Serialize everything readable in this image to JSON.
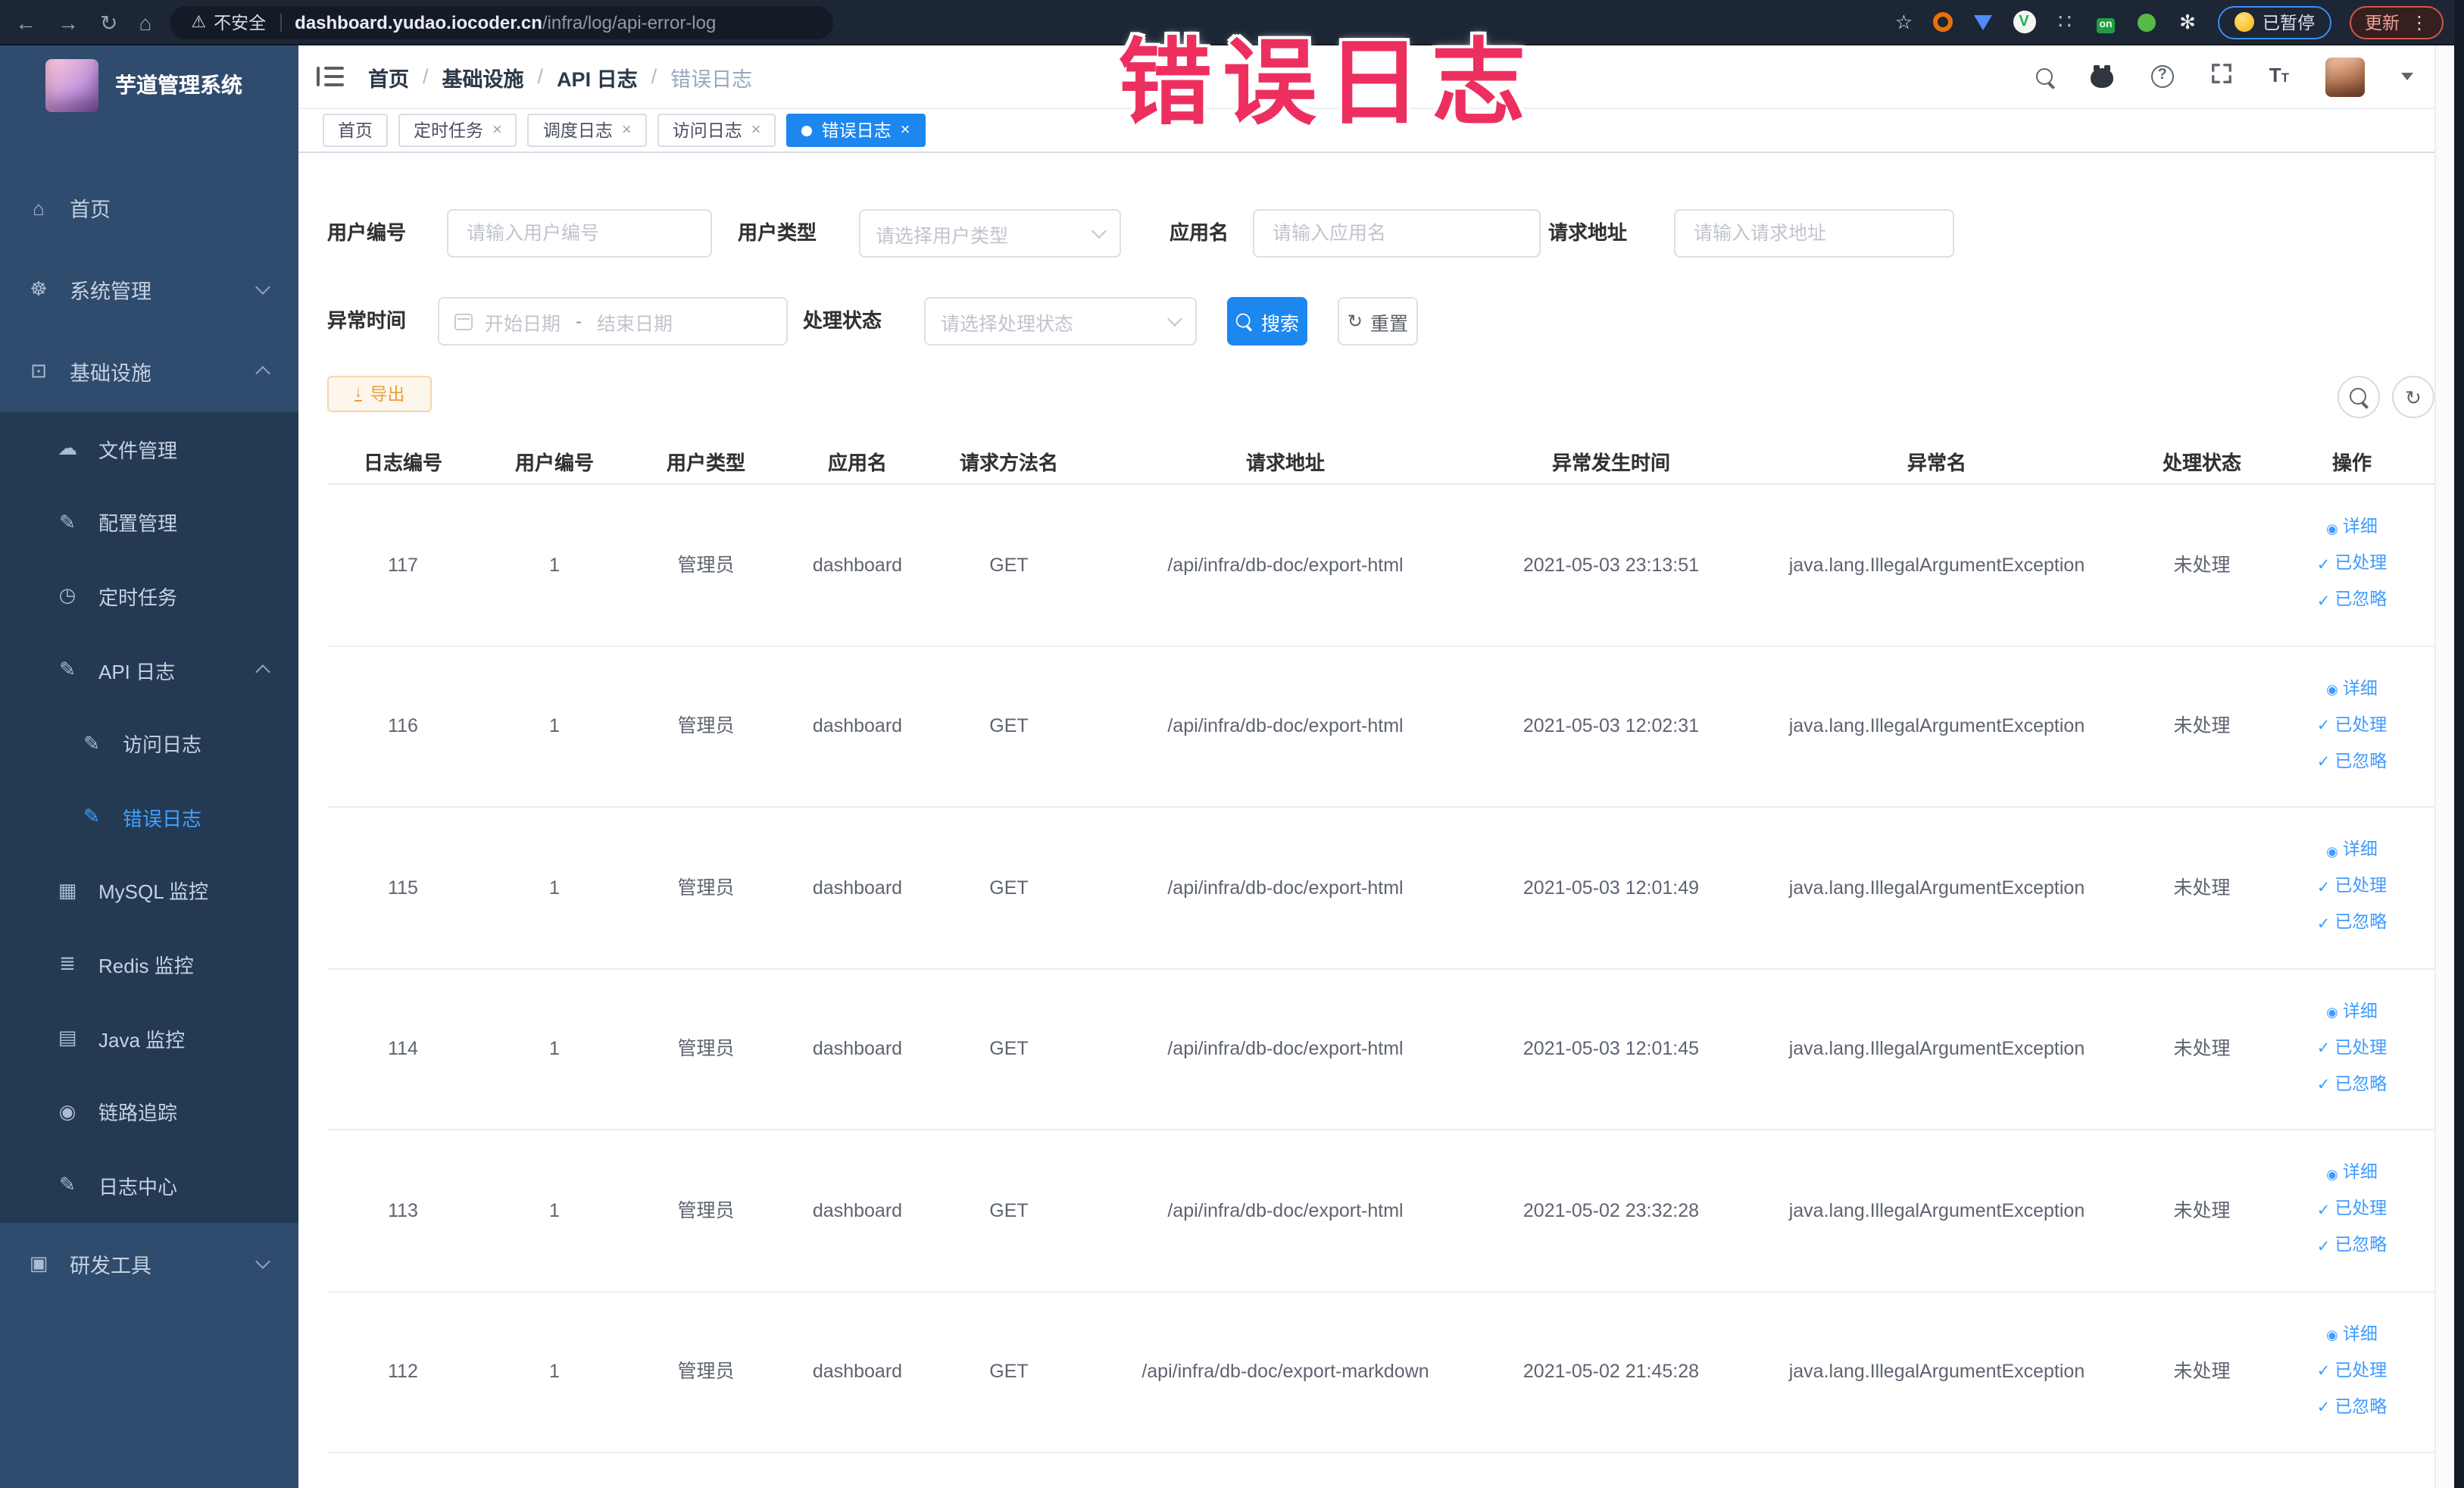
{
  "browser": {
    "security_label": "不安全",
    "url_domain": "dashboard.yudao.iocoder.cn",
    "url_path": "/infra/log/api-error-log",
    "paused_label": "已暂停",
    "update_label": "更新"
  },
  "annotation": {
    "text": "错误日志",
    "color": "#ed2f5f"
  },
  "sidebar": {
    "title": "芋道管理系统",
    "items": [
      {
        "key": "home",
        "label": "首页",
        "icon": "dashboard-icon",
        "level": 0,
        "sub": false
      },
      {
        "key": "system-mgmt",
        "label": "系统管理",
        "icon": "gear-icon",
        "level": 0,
        "sub": false,
        "arrow": "down"
      },
      {
        "key": "infrastructure",
        "label": "基础设施",
        "icon": "infra-monitor-icon",
        "level": 0,
        "sub": false,
        "arrow": "up"
      },
      {
        "key": "file-mgmt",
        "label": "文件管理",
        "icon": "cloud-upload-icon",
        "level": 1,
        "sub": true
      },
      {
        "key": "config-mgmt",
        "label": "配置管理",
        "icon": "edit-square-icon",
        "level": 1,
        "sub": true
      },
      {
        "key": "cron-job",
        "label": "定时任务",
        "icon": "clock-icon",
        "level": 1,
        "sub": true
      },
      {
        "key": "api-log",
        "label": "API 日志",
        "icon": "log-edit-icon",
        "level": 1,
        "sub": true,
        "arrow": "up"
      },
      {
        "key": "access-log",
        "label": "访问日志",
        "icon": "log-edit-icon",
        "level": 2,
        "sub": true
      },
      {
        "key": "error-log",
        "label": "错误日志",
        "icon": "log-edit-icon",
        "level": 2,
        "sub": true,
        "active": true
      },
      {
        "key": "mysql-monitor",
        "label": "MySQL 监控",
        "icon": "chart-icon",
        "level": 1,
        "sub": true
      },
      {
        "key": "redis-monitor",
        "label": "Redis 监控",
        "icon": "layers-icon",
        "level": 1,
        "sub": true
      },
      {
        "key": "java-monitor",
        "label": "Java 监控",
        "icon": "monitor-icon",
        "level": 1,
        "sub": true
      },
      {
        "key": "trace",
        "label": "链路追踪",
        "icon": "eye-icon",
        "level": 1,
        "sub": true
      },
      {
        "key": "log-center",
        "label": "日志中心",
        "icon": "log-edit-icon",
        "level": 1,
        "sub": true
      },
      {
        "key": "dev-tools",
        "label": "研发工具",
        "icon": "toolbox-icon",
        "level": 0,
        "sub": false,
        "arrow": "down"
      }
    ]
  },
  "header": {
    "breadcrumb": [
      "首页",
      "基础设施",
      "API 日志",
      "错误日志"
    ]
  },
  "tabs": [
    {
      "key": "home",
      "label": "首页",
      "closable": false,
      "active": false
    },
    {
      "key": "cron-job",
      "label": "定时任务",
      "closable": true,
      "active": false
    },
    {
      "key": "schedule-log",
      "label": "调度日志",
      "closable": true,
      "active": false
    },
    {
      "key": "access-log",
      "label": "访问日志",
      "closable": true,
      "active": false
    },
    {
      "key": "error-log",
      "label": "错误日志",
      "closable": true,
      "active": true
    }
  ],
  "filters": {
    "user_id": {
      "label": "用户编号",
      "placeholder": "请输入用户编号"
    },
    "user_type": {
      "label": "用户类型",
      "placeholder": "请选择用户类型"
    },
    "app_name": {
      "label": "应用名",
      "placeholder": "请输入应用名"
    },
    "req_url": {
      "label": "请求地址",
      "placeholder": "请输入请求地址"
    },
    "exc_time": {
      "label": "异常时间",
      "start_placeholder": "开始日期",
      "separator": "-",
      "end_placeholder": "结束日期"
    },
    "status": {
      "label": "处理状态",
      "placeholder": "请选择处理状态"
    },
    "search_label": "搜索",
    "reset_label": "重置"
  },
  "toolbar": {
    "export_label": "导出"
  },
  "table": {
    "columns": [
      "日志编号",
      "用户编号",
      "用户类型",
      "应用名",
      "请求方法名",
      "请求地址",
      "异常发生时间",
      "异常名",
      "处理状态",
      "操作"
    ],
    "column_keys": [
      "id",
      "user_id",
      "user_type",
      "app",
      "method",
      "url",
      "time",
      "exception",
      "status"
    ],
    "actions": [
      {
        "key": "detail",
        "label": "详细",
        "icon": "eye-icon"
      },
      {
        "key": "processed",
        "label": "已处理",
        "icon": "check-icon"
      },
      {
        "key": "ignored",
        "label": "已忽略",
        "icon": "check-icon"
      }
    ],
    "rows": [
      {
        "id": "117",
        "user_id": "1",
        "user_type": "管理员",
        "app": "dashboard",
        "method": "GET",
        "url": "/api/infra/db-doc/export-html",
        "time": "2021-05-03 23:13:51",
        "exception": "java.lang.IllegalArgumentException",
        "status": "未处理"
      },
      {
        "id": "116",
        "user_id": "1",
        "user_type": "管理员",
        "app": "dashboard",
        "method": "GET",
        "url": "/api/infra/db-doc/export-html",
        "time": "2021-05-03 12:02:31",
        "exception": "java.lang.IllegalArgumentException",
        "status": "未处理"
      },
      {
        "id": "115",
        "user_id": "1",
        "user_type": "管理员",
        "app": "dashboard",
        "method": "GET",
        "url": "/api/infra/db-doc/export-html",
        "time": "2021-05-03 12:01:49",
        "exception": "java.lang.IllegalArgumentException",
        "status": "未处理"
      },
      {
        "id": "114",
        "user_id": "1",
        "user_type": "管理员",
        "app": "dashboard",
        "method": "GET",
        "url": "/api/infra/db-doc/export-html",
        "time": "2021-05-03 12:01:45",
        "exception": "java.lang.IllegalArgumentException",
        "status": "未处理"
      },
      {
        "id": "113",
        "user_id": "1",
        "user_type": "管理员",
        "app": "dashboard",
        "method": "GET",
        "url": "/api/infra/db-doc/export-html",
        "time": "2021-05-02 23:32:28",
        "exception": "java.lang.IllegalArgumentException",
        "status": "未处理"
      },
      {
        "id": "112",
        "user_id": "1",
        "user_type": "管理员",
        "app": "dashboard",
        "method": "GET",
        "url": "/api/infra/db-doc/export-markdown",
        "time": "2021-05-02 21:45:28",
        "exception": "java.lang.IllegalArgumentException",
        "status": "未处理"
      }
    ]
  },
  "colors": {
    "accent": "#1d87f0",
    "link": "#3f9bff",
    "warning": "#e6a23c",
    "sidebar_bg": "#2f4b6e",
    "submenu_bg": "#243a53",
    "annotation": "#ed2f5f",
    "chrome_bg": "#1d2634"
  }
}
